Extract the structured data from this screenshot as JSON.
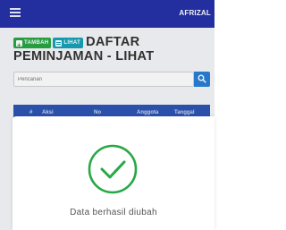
{
  "topbar": {
    "menu_icon": "hamburger-icon",
    "username": "AFRIZAL"
  },
  "toolbar": {
    "tambah_label": "TAMBAH",
    "lihat_label": "LIHAT"
  },
  "page": {
    "title_line1": "DAFTAR",
    "title_line2": "PEMINJAMAN - LIHAT"
  },
  "search": {
    "placeholder": "Pencarian",
    "button_icon": "search-icon"
  },
  "table": {
    "columns": [
      "#",
      "Aksi",
      "No",
      "Anggota",
      "Tanggal"
    ]
  },
  "dialog": {
    "icon": "check-circle-icon",
    "message": "Data berhasil diubah"
  },
  "colors": {
    "topbar": "#2532a8",
    "tambah": "#28a745",
    "lihat": "#17a2b8",
    "search_button": "#2a7ed6",
    "table_header": "#2d55b5",
    "success": "#28a745"
  }
}
